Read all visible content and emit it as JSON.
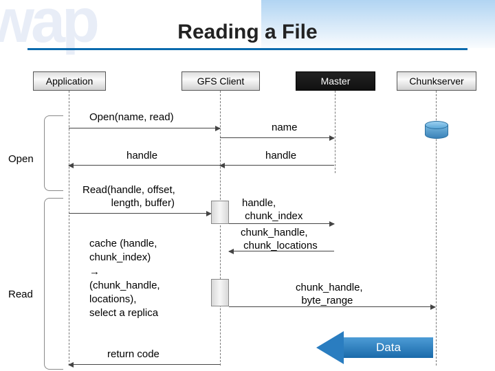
{
  "title": "Reading a File",
  "actors": {
    "application": "Application",
    "gfs_client": "GFS Client",
    "master": "Master",
    "chunkserver": "Chunkserver"
  },
  "side_labels": {
    "open": "Open",
    "read": "Read"
  },
  "messages": {
    "open_call": "Open(name, read)",
    "name": "name",
    "handle_left": "handle",
    "handle_right": "handle",
    "read_call": "Read(handle, offset,\n          length, buffer)",
    "handle_chunk_index": "handle,\n chunk_index",
    "chunk_handle_locations": "chunk_handle,\n chunk_locations",
    "cache_note": "cache (handle,\nchunk_index)\n→\n(chunk_handle,\nlocations),\nselect a replica",
    "chunk_request": "chunk_handle,\n  byte_range",
    "return_code": "return code",
    "data": "Data"
  }
}
